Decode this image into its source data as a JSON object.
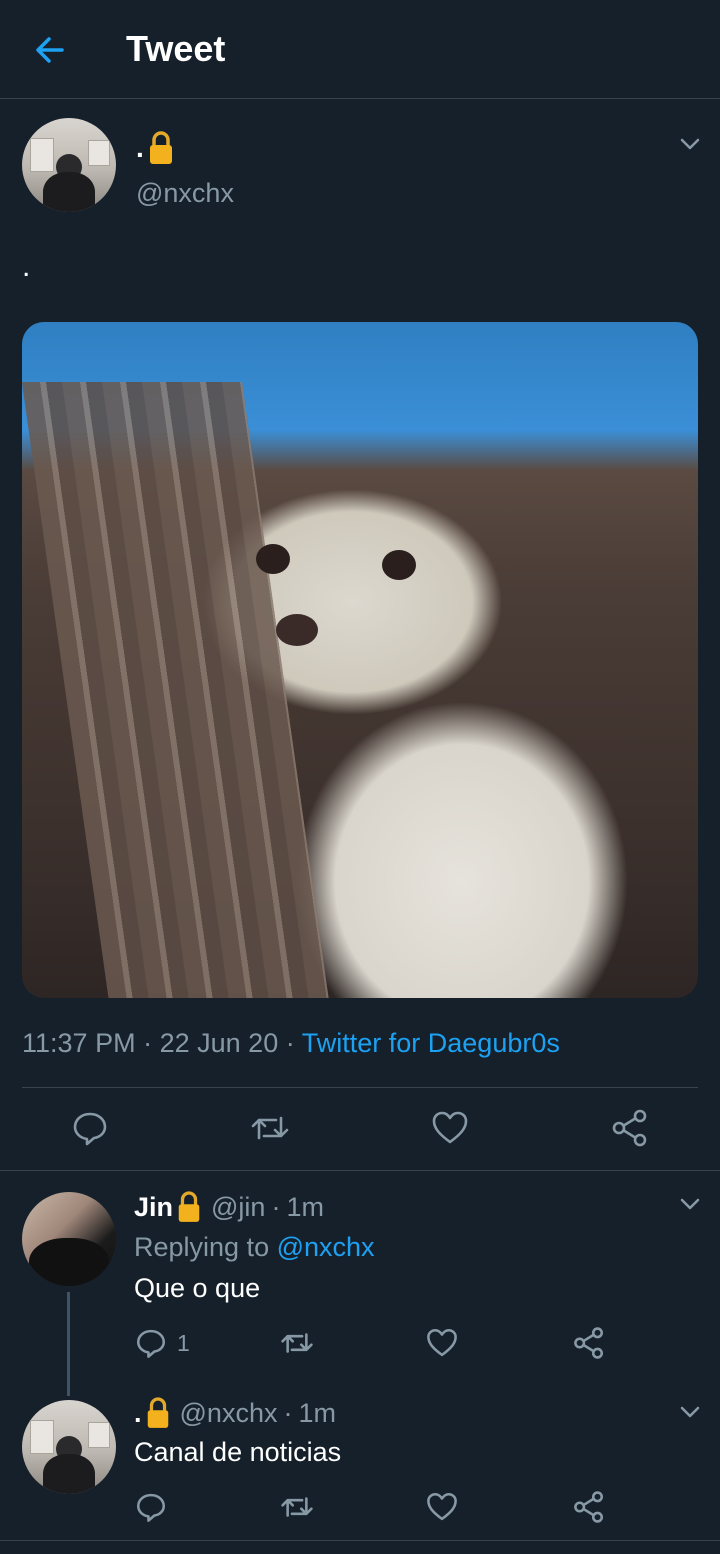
{
  "header": {
    "title": "Tweet",
    "back_icon": "arrow-left-icon"
  },
  "tweet": {
    "display_name": ".",
    "lock_icon": "🔒",
    "handle": "@nxchx",
    "text": ".",
    "time": "11:37 PM",
    "separator": "·",
    "date": "22 Jun 20",
    "source": "Twitter for Daegubr0s"
  },
  "replies": [
    {
      "display_name": "Jin",
      "lock_icon": "🔒",
      "handle": "@jin",
      "dot": "·",
      "time": "1m",
      "replying_prefix": "Replying to",
      "replying_to": "@nxchx",
      "text": "Que o que",
      "reply_count": "1"
    },
    {
      "display_name": ".",
      "lock_icon": "🔒",
      "handle": "@nxchx",
      "dot": "·",
      "time": "1m",
      "text": "Canal de noticias"
    }
  ],
  "colors": {
    "background": "#15202b",
    "accent": "#1da1f2",
    "muted": "#8899a6",
    "divider": "#38444d"
  }
}
